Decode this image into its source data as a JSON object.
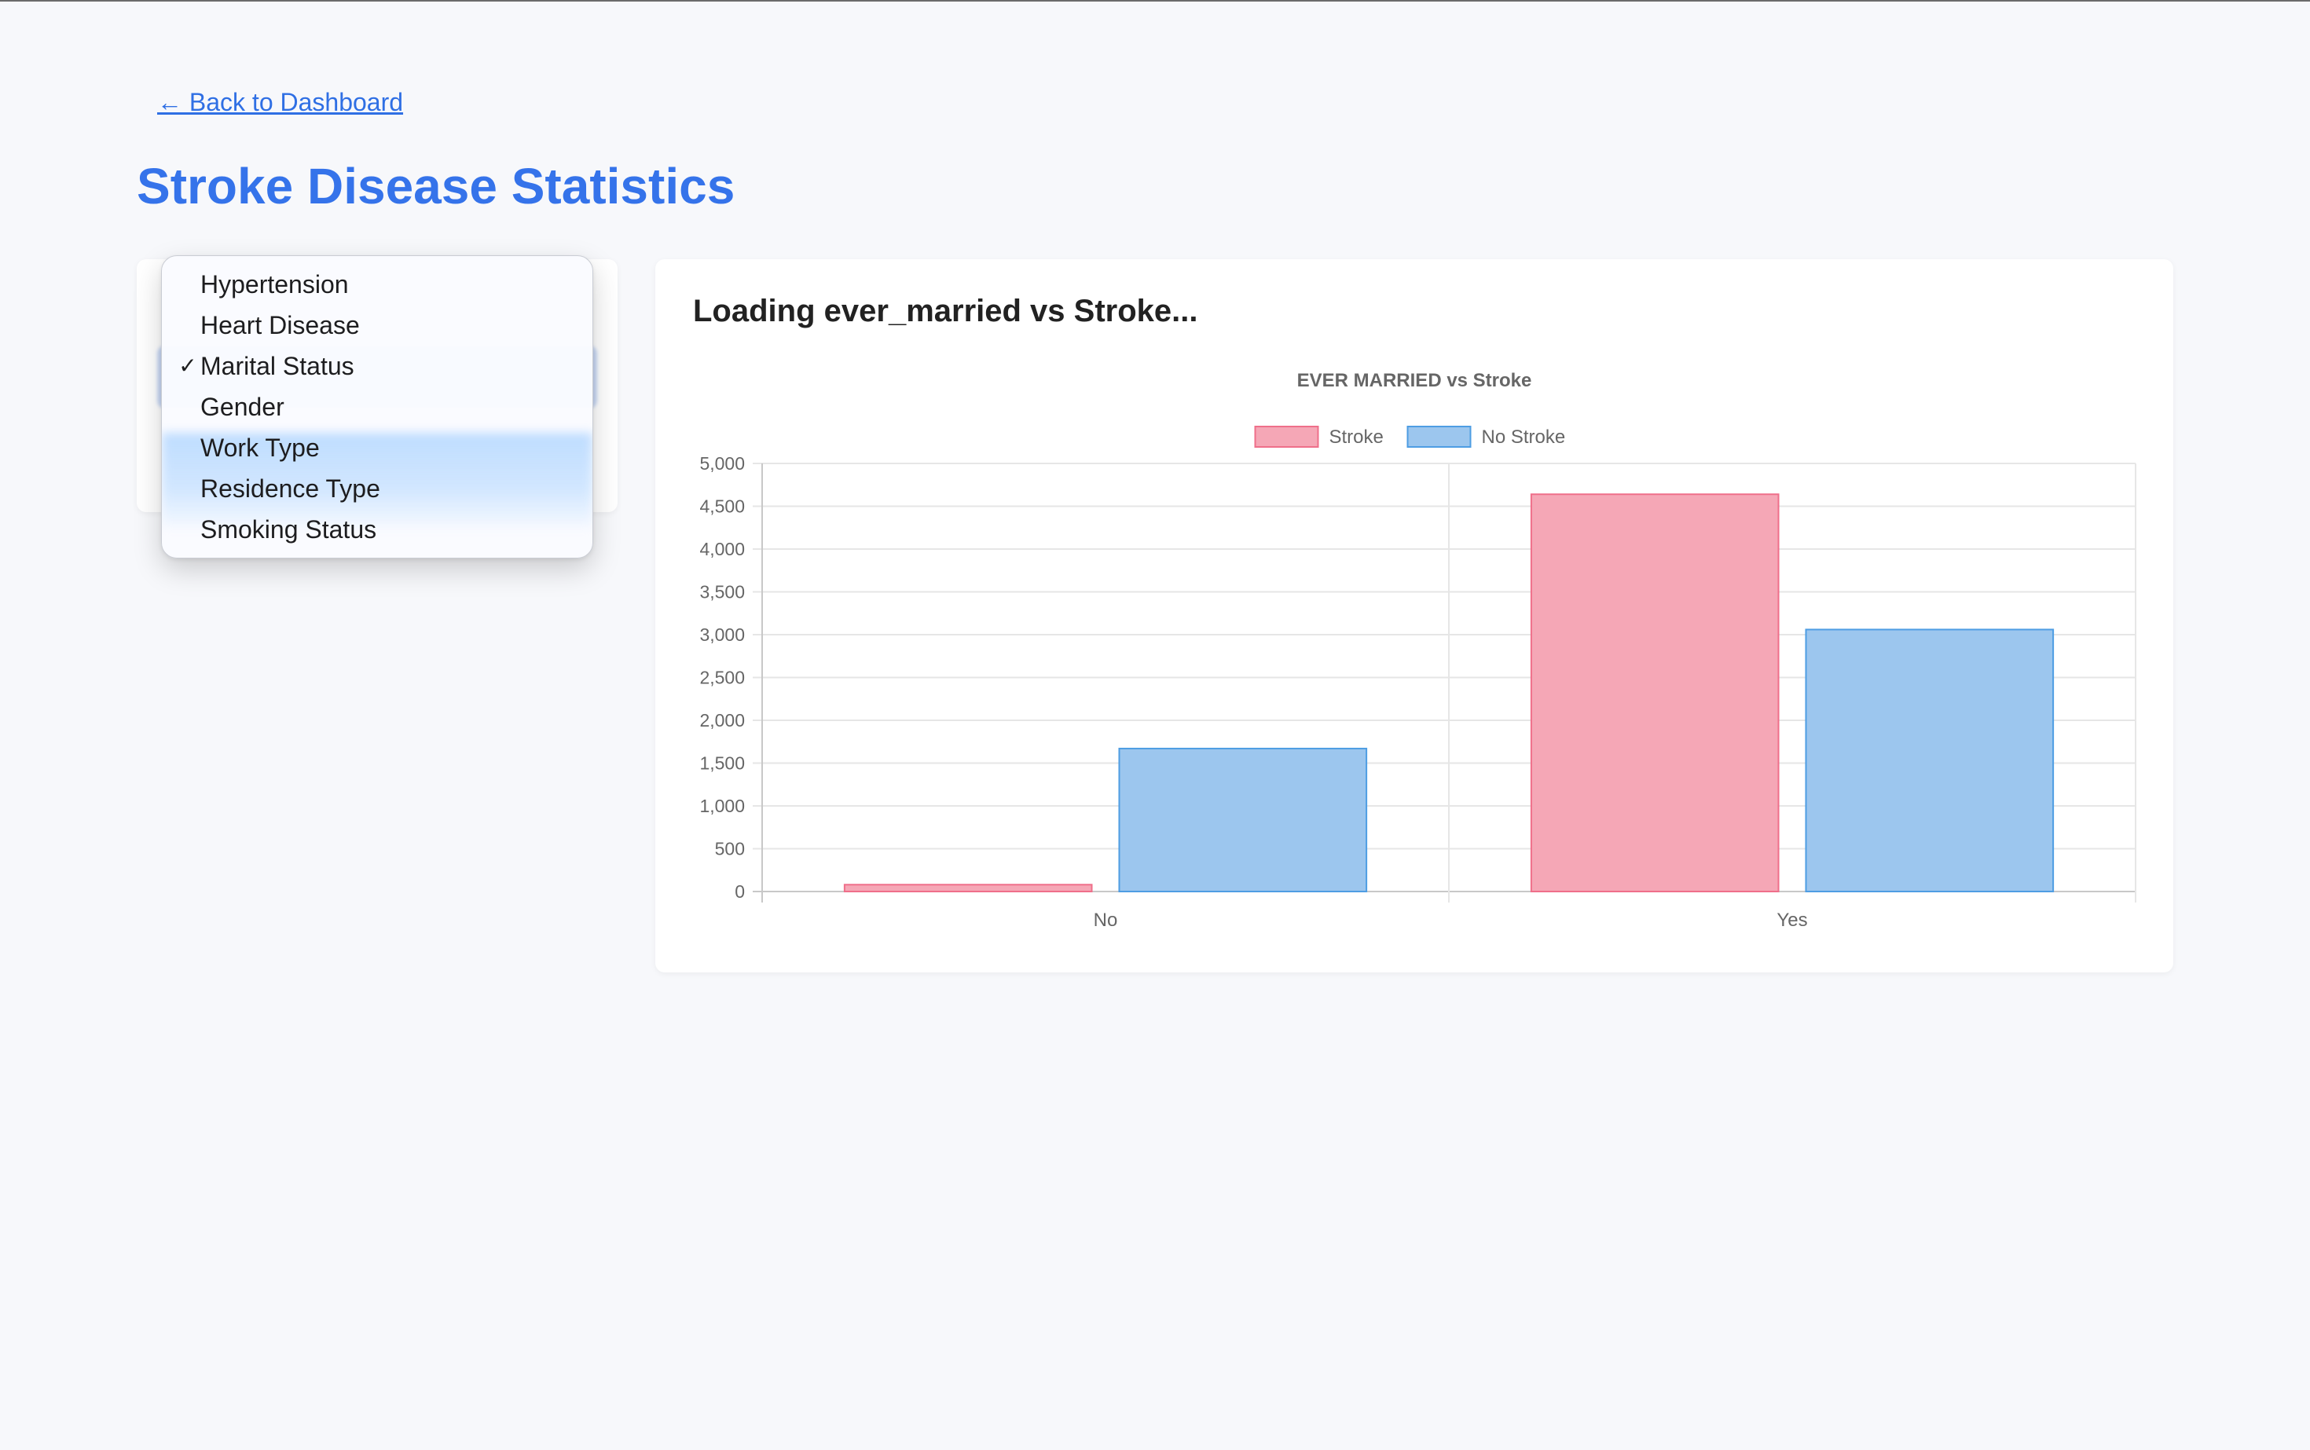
{
  "nav": {
    "back_label": "← Back to Dashboard"
  },
  "page": {
    "title": "Stroke Disease Statistics"
  },
  "selector": {
    "options": [
      {
        "label": "Hypertension",
        "selected": false
      },
      {
        "label": "Heart Disease",
        "selected": false
      },
      {
        "label": "Marital Status",
        "selected": true
      },
      {
        "label": "Gender",
        "selected": false
      },
      {
        "label": "Work Type",
        "selected": false
      },
      {
        "label": "Residence Type",
        "selected": false
      },
      {
        "label": "Smoking Status",
        "selected": false
      }
    ],
    "check_glyph": "✓"
  },
  "chart_panel": {
    "heading": "Loading ever_married vs Stroke..."
  },
  "chart_data": {
    "type": "bar",
    "title": "EVER MARRIED vs Stroke",
    "categories": [
      "No",
      "Yes"
    ],
    "series": [
      {
        "name": "Stroke",
        "values": [
          80,
          4640
        ],
        "color": "#f5a7b6",
        "border": "#ef6f8a"
      },
      {
        "name": "No Stroke",
        "values": [
          1670,
          3060
        ],
        "color": "#9cc6ee",
        "border": "#4e9de3"
      }
    ],
    "ylim": [
      0,
      5000
    ],
    "yticks": [
      "0",
      "500",
      "1,000",
      "1,500",
      "2,000",
      "2,500",
      "3,000",
      "3,500",
      "4,000",
      "4,500",
      "5,000"
    ],
    "grid": true,
    "legend": "top-center"
  }
}
